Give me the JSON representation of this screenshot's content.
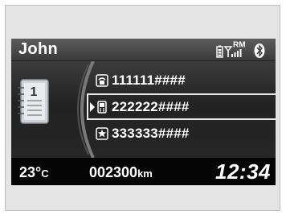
{
  "header": {
    "user_name": "John",
    "status_icons": [
      "phone-battery-icon",
      "signal-strength-icon",
      "bluetooth-icon"
    ],
    "roaming_label": "RM"
  },
  "contacts": [
    {
      "icon": "home-phone-icon",
      "number": "111111####",
      "selected": false
    },
    {
      "icon": "mobile-phone-icon",
      "number": "222222####",
      "selected": true
    },
    {
      "icon": "star-icon",
      "number": "333333####",
      "selected": false
    }
  ],
  "phonebook": {
    "icon": "phonebook-icon",
    "page_label": "1"
  },
  "footer": {
    "temperature": "23°",
    "temperature_unit": "C",
    "odometer": "002300",
    "odometer_unit": "km",
    "clock": "12:34"
  },
  "colors": {
    "screen_bg": "#000000",
    "header_bg": "#4a4a4a",
    "frame_bg": "#e4e4e4",
    "text": "#ffffff"
  }
}
